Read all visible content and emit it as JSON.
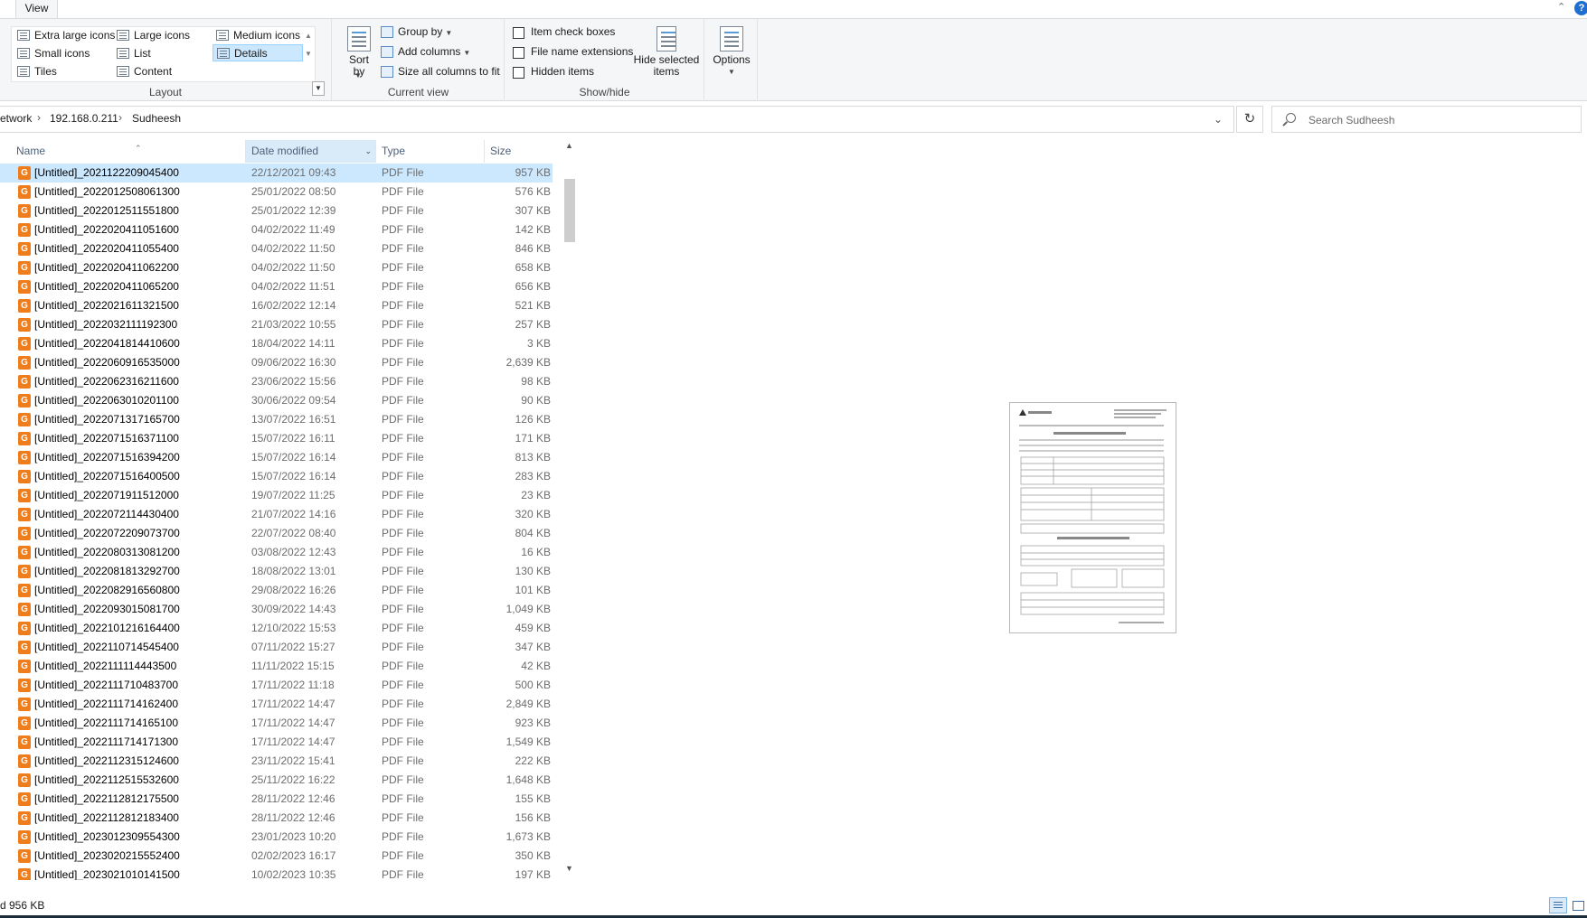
{
  "tabs": {
    "view": "View"
  },
  "ribbon": {
    "layout": {
      "label": "Layout",
      "options": [
        "Extra large icons",
        "Large icons",
        "Medium icons",
        "Small icons",
        "List",
        "Details",
        "Tiles",
        "Content"
      ],
      "selected": "Details"
    },
    "current_view": {
      "label": "Current view",
      "sort_by": "Sort by",
      "group_by": "Group by",
      "add_columns": "Add columns",
      "size_all_columns": "Size all columns to fit"
    },
    "show_hide": {
      "label": "Show/hide",
      "item_check_boxes": "Item check boxes",
      "file_name_extensions": "File name extensions",
      "hidden_items": "Hidden items",
      "hide_selected_line1": "Hide selected",
      "hide_selected_line2": "items"
    },
    "options": {
      "label": "Options"
    }
  },
  "address": {
    "crumbs": [
      "etwork",
      "192.168.0.211",
      "Sudheesh"
    ],
    "search_placeholder": "Search Sudheesh"
  },
  "columns": {
    "name": "Name",
    "date": "Date modified",
    "type": "Type",
    "size": "Size"
  },
  "files": [
    {
      "name": "[Untitled]_2021122209045400",
      "date": "22/12/2021 09:43",
      "type": "PDF File",
      "size": "957 KB"
    },
    {
      "name": "[Untitled]_2022012508061300",
      "date": "25/01/2022 08:50",
      "type": "PDF File",
      "size": "576 KB"
    },
    {
      "name": "[Untitled]_2022012511551800",
      "date": "25/01/2022 12:39",
      "type": "PDF File",
      "size": "307 KB"
    },
    {
      "name": "[Untitled]_2022020411051600",
      "date": "04/02/2022 11:49",
      "type": "PDF File",
      "size": "142 KB"
    },
    {
      "name": "[Untitled]_2022020411055400",
      "date": "04/02/2022 11:50",
      "type": "PDF File",
      "size": "846 KB"
    },
    {
      "name": "[Untitled]_2022020411062200",
      "date": "04/02/2022 11:50",
      "type": "PDF File",
      "size": "658 KB"
    },
    {
      "name": "[Untitled]_2022020411065200",
      "date": "04/02/2022 11:51",
      "type": "PDF File",
      "size": "656 KB"
    },
    {
      "name": "[Untitled]_2022021611321500",
      "date": "16/02/2022 12:14",
      "type": "PDF File",
      "size": "521 KB"
    },
    {
      "name": "[Untitled]_2022032111192300",
      "date": "21/03/2022 10:55",
      "type": "PDF File",
      "size": "257 KB"
    },
    {
      "name": "[Untitled]_2022041814410600",
      "date": "18/04/2022 14:11",
      "type": "PDF File",
      "size": "3 KB"
    },
    {
      "name": "[Untitled]_2022060916535000",
      "date": "09/06/2022 16:30",
      "type": "PDF File",
      "size": "2,639 KB"
    },
    {
      "name": "[Untitled]_2022062316211600",
      "date": "23/06/2022 15:56",
      "type": "PDF File",
      "size": "98 KB"
    },
    {
      "name": "[Untitled]_2022063010201100",
      "date": "30/06/2022 09:54",
      "type": "PDF File",
      "size": "90 KB"
    },
    {
      "name": "[Untitled]_2022071317165700",
      "date": "13/07/2022 16:51",
      "type": "PDF File",
      "size": "126 KB"
    },
    {
      "name": "[Untitled]_2022071516371100",
      "date": "15/07/2022 16:11",
      "type": "PDF File",
      "size": "171 KB"
    },
    {
      "name": "[Untitled]_2022071516394200",
      "date": "15/07/2022 16:14",
      "type": "PDF File",
      "size": "813 KB"
    },
    {
      "name": "[Untitled]_2022071516400500",
      "date": "15/07/2022 16:14",
      "type": "PDF File",
      "size": "283 KB"
    },
    {
      "name": "[Untitled]_2022071911512000",
      "date": "19/07/2022 11:25",
      "type": "PDF File",
      "size": "23 KB"
    },
    {
      "name": "[Untitled]_2022072114430400",
      "date": "21/07/2022 14:16",
      "type": "PDF File",
      "size": "320 KB"
    },
    {
      "name": "[Untitled]_2022072209073700",
      "date": "22/07/2022 08:40",
      "type": "PDF File",
      "size": "804 KB"
    },
    {
      "name": "[Untitled]_2022080313081200",
      "date": "03/08/2022 12:43",
      "type": "PDF File",
      "size": "16 KB"
    },
    {
      "name": "[Untitled]_2022081813292700",
      "date": "18/08/2022 13:01",
      "type": "PDF File",
      "size": "130 KB"
    },
    {
      "name": "[Untitled]_2022082916560800",
      "date": "29/08/2022 16:26",
      "type": "PDF File",
      "size": "101 KB"
    },
    {
      "name": "[Untitled]_2022093015081700",
      "date": "30/09/2022 14:43",
      "type": "PDF File",
      "size": "1,049 KB"
    },
    {
      "name": "[Untitled]_2022101216164400",
      "date": "12/10/2022 15:53",
      "type": "PDF File",
      "size": "459 KB"
    },
    {
      "name": "[Untitled]_2022110714545400",
      "date": "07/11/2022 15:27",
      "type": "PDF File",
      "size": "347 KB"
    },
    {
      "name": "[Untitled]_2022111114443500",
      "date": "11/11/2022 15:15",
      "type": "PDF File",
      "size": "42 KB"
    },
    {
      "name": "[Untitled]_2022111710483700",
      "date": "17/11/2022 11:18",
      "type": "PDF File",
      "size": "500 KB"
    },
    {
      "name": "[Untitled]_2022111714162400",
      "date": "17/11/2022 14:47",
      "type": "PDF File",
      "size": "2,849 KB"
    },
    {
      "name": "[Untitled]_2022111714165100",
      "date": "17/11/2022 14:47",
      "type": "PDF File",
      "size": "923 KB"
    },
    {
      "name": "[Untitled]_2022111714171300",
      "date": "17/11/2022 14:47",
      "type": "PDF File",
      "size": "1,549 KB"
    },
    {
      "name": "[Untitled]_2022112315124600",
      "date": "23/11/2022 15:41",
      "type": "PDF File",
      "size": "222 KB"
    },
    {
      "name": "[Untitled]_2022112515532600",
      "date": "25/11/2022 16:22",
      "type": "PDF File",
      "size": "1,648 KB"
    },
    {
      "name": "[Untitled]_2022112812175500",
      "date": "28/11/2022 12:46",
      "type": "PDF File",
      "size": "155 KB"
    },
    {
      "name": "[Untitled]_2022112812183400",
      "date": "28/11/2022 12:46",
      "type": "PDF File",
      "size": "156 KB"
    },
    {
      "name": "[Untitled]_2023012309554300",
      "date": "23/01/2023 10:20",
      "type": "PDF File",
      "size": "1,673 KB"
    },
    {
      "name": "[Untitled]_2023020215552400",
      "date": "02/02/2023 16:17",
      "type": "PDF File",
      "size": "350 KB"
    },
    {
      "name": "[Untitled]_2023021010141500",
      "date": "10/02/2023 10:35",
      "type": "PDF File",
      "size": "197 KB"
    }
  ],
  "selected_index": 0,
  "file_icon_glyph": "G",
  "status": "d 956 KB",
  "colors": {
    "file_icon": "#ef7d1b",
    "selection": "#cce8ff",
    "accent": "#1e6fd0"
  }
}
